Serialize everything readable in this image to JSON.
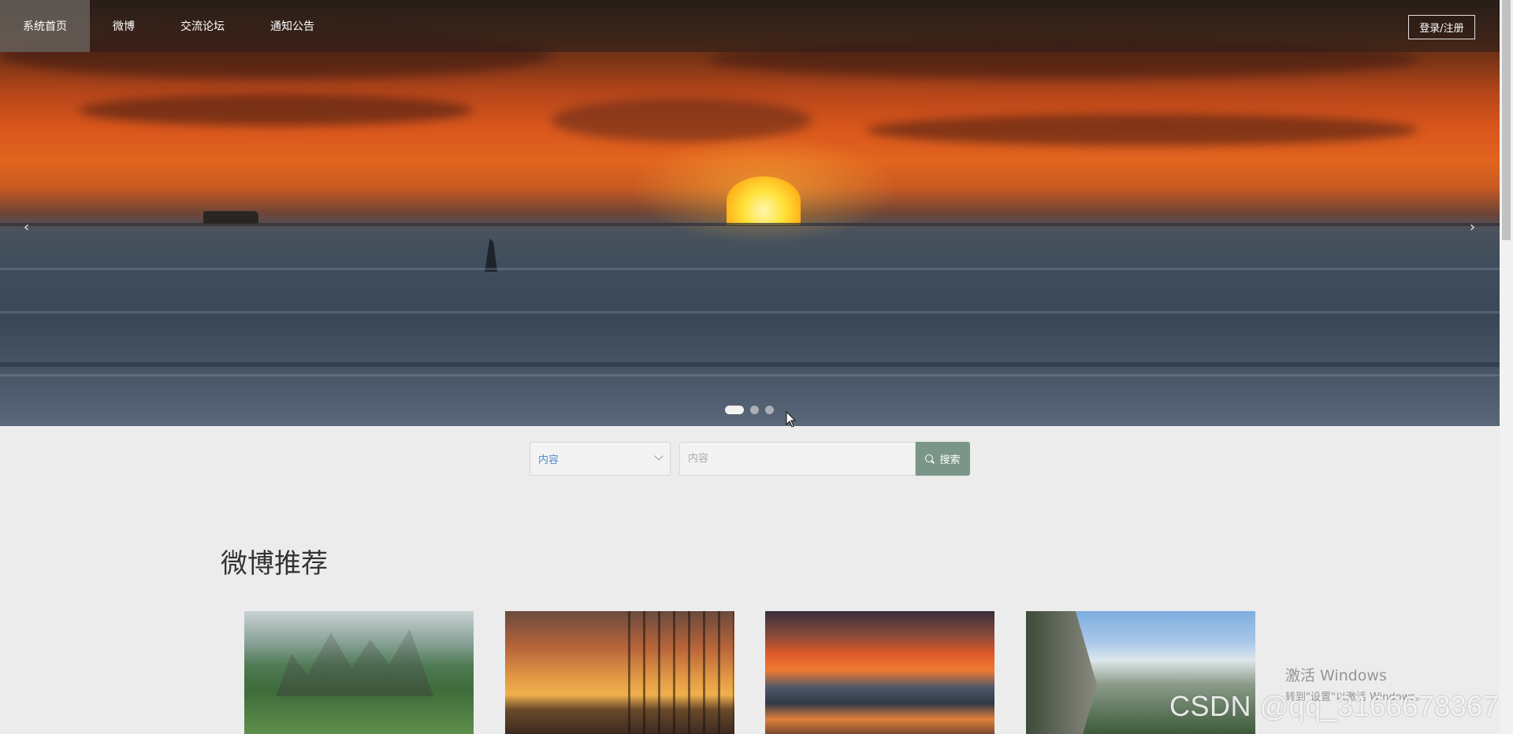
{
  "nav": {
    "items": [
      {
        "label": "系统首页",
        "active": true
      },
      {
        "label": "微博",
        "active": false
      },
      {
        "label": "交流论坛",
        "active": false
      },
      {
        "label": "通知公告",
        "active": false
      }
    ],
    "login_label": "登录/注册"
  },
  "banner": {
    "prev_icon": "‹",
    "next_icon": "›",
    "slide_count": 3,
    "active_slide": 1
  },
  "search": {
    "select_value": "内容",
    "input_placeholder": "内容",
    "button_label": "搜索",
    "button_color": "#7b9688"
  },
  "section": {
    "title": "微博推荐"
  },
  "watermarks": {
    "windows_line1": "激活 Windows",
    "windows_line2": "转到\"设置\"以激活 Windows。",
    "csdn": "CSDN @qq_3166678367"
  },
  "colors": {
    "page_bg": "#ececec",
    "nav_active_bg": "#78736e"
  }
}
